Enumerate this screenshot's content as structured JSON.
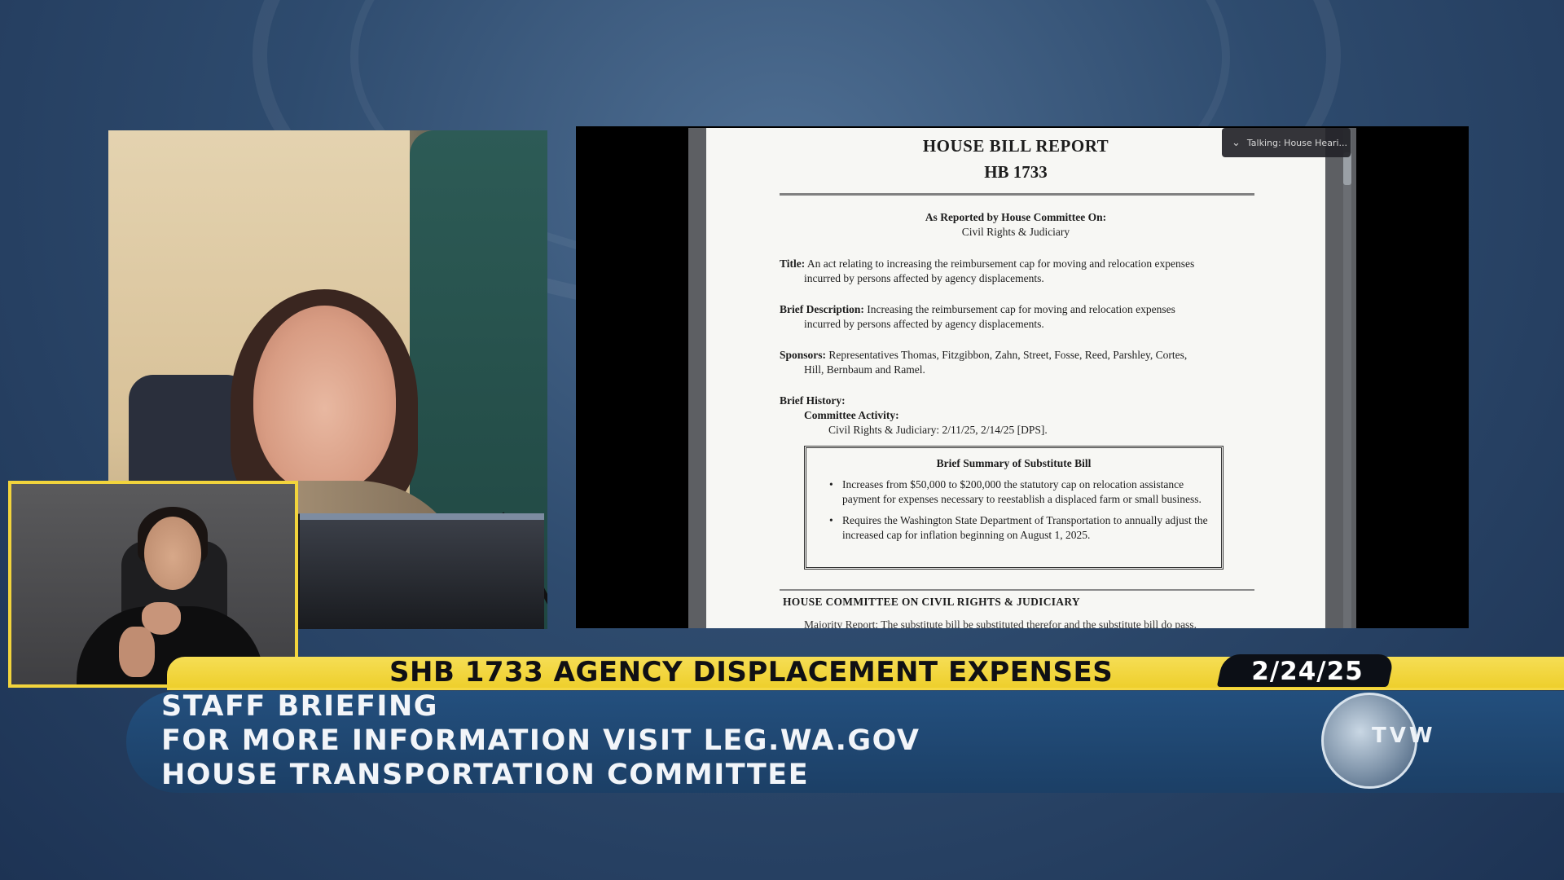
{
  "lower_third": {
    "bill_title": "SHB 1733 AGENCY DISPLACEMENT EXPENSES",
    "date": "2/24/25",
    "lines": [
      "STAFF BRIEFING",
      "FOR MORE INFORMATION VISIT LEG.WA.GOV",
      "HOUSE TRANSPORTATION COMMITTEE"
    ],
    "logo_text": "TVW"
  },
  "presentation": {
    "talking_indicator": "Talking: House Heari...",
    "document": {
      "title": "HOUSE BILL REPORT",
      "bill_number": "HB 1733",
      "reported_by": "As Reported by House Committee On:",
      "committee": "Civil Rights & Judiciary",
      "title_label": "Title:",
      "title_text_1": "An act relating to increasing the reimbursement cap for moving and relocation expenses",
      "title_text_2": "incurred by persons affected by agency displacements.",
      "brief_desc_label": "Brief Description:",
      "brief_desc_text_1": "Increasing the reimbursement cap for moving and relocation expenses",
      "brief_desc_text_2": "incurred by persons affected by agency displacements.",
      "sponsors_label": "Sponsors:",
      "sponsors_text_1": "Representatives Thomas, Fitzgibbon, Zahn, Street, Fosse, Reed, Parshley, Cortes,",
      "sponsors_text_2": "Hill, Bernbaum and Ramel.",
      "brief_history_label": "Brief History:",
      "committee_activity_label": "Committee Activity:",
      "committee_activity_text": "Civil Rights & Judiciary: 2/11/25, 2/14/25 [DPS].",
      "summary_title": "Brief Summary of Substitute Bill",
      "summary_bullets": [
        "Increases from $50,000 to $200,000 the statutory cap on relocation assistance payment for expenses necessary to reestablish a displaced farm or small business.",
        "Requires the Washington State Department of Transportation to annually adjust the increased cap for inflation beginning on August 1, 2025."
      ],
      "section_heading": "HOUSE COMMITTEE ON CIVIL RIGHTS & JUDICIARY",
      "cut_line": "Majority Report: The substitute bill be substituted therefor and the substitute bill do pass."
    }
  },
  "colors": {
    "accent_yellow": "#f2d43c",
    "band_blue": "#1f4a76",
    "date_tab": "#0c0f16"
  }
}
